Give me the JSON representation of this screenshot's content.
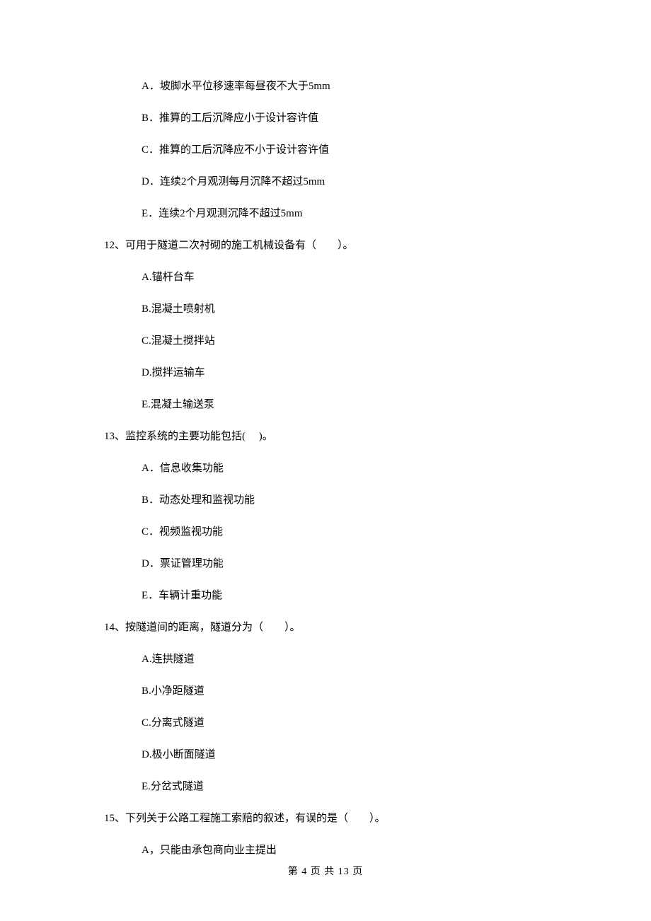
{
  "options_pre": [
    "A．坡脚水平位移速率每昼夜不大于5mm",
    "B．推算的工后沉降应小于设计容许值",
    "C．推算的工后沉降应不小于设计容许值",
    "D．连续2个月观测每月沉降不超过5mm",
    "E．连续2个月观测沉降不超过5mm"
  ],
  "q12": {
    "stem": "12、可用于隧道二次衬砌的施工机械设备有（　　）。",
    "options": [
      "A.锚杆台车",
      "B.混凝土喷射机",
      "C.混凝土搅拌站",
      "D.搅拌运输车",
      "E.混凝土输送泵"
    ]
  },
  "q13": {
    "stem": "13、监控系统的主要功能包括(　 )。",
    "options": [
      "A．信息收集功能",
      "B．动态处理和监视功能",
      "C．视频监视功能",
      "D．票证管理功能",
      "E．车辆计重功能"
    ]
  },
  "q14": {
    "stem": "14、按隧道间的距离，隧道分为（　　）。",
    "options": [
      "A.连拱隧道",
      "B.小净距隧道",
      "C.分离式隧道",
      "D.极小断面隧道",
      "E.分岔式隧道"
    ]
  },
  "q15": {
    "stem": "15、下列关于公路工程施工索赔的叙述，有误的是（　　）。",
    "options": [
      "A，只能由承包商向业主提出"
    ]
  },
  "footer": "第 4 页 共 13 页"
}
